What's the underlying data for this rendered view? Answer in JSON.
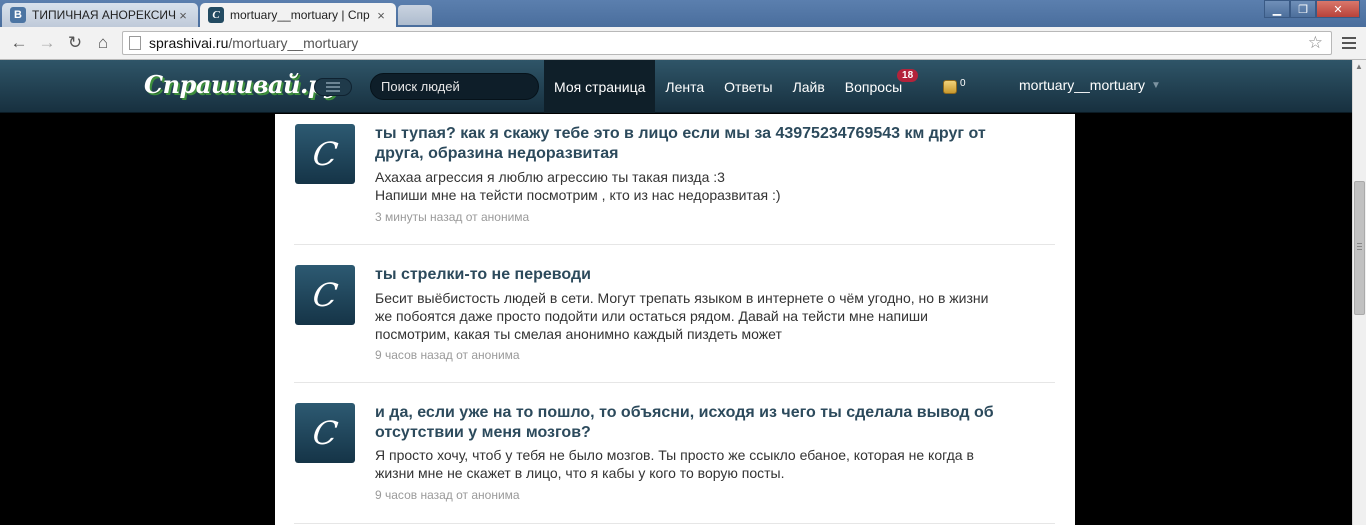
{
  "browser": {
    "tabs": [
      {
        "title": "ТИПИЧНАЯ АНОРЕКСИЧ",
        "favicon": "vk-icon",
        "active": false
      },
      {
        "title": "mortuary__mortuary | Спр",
        "favicon": "sprashivai-icon",
        "active": true
      }
    ],
    "close_glyph": "×",
    "address": {
      "host": "sprashivai.ru",
      "path": "/mortuary__mortuary"
    }
  },
  "site": {
    "logo": "Спрашивай.ру",
    "search_placeholder": "Поиск людей",
    "nav": [
      {
        "label": "Моя страница",
        "active": true
      },
      {
        "label": "Лента"
      },
      {
        "label": "Ответы"
      },
      {
        "label": "Лайв"
      },
      {
        "label": "Вопросы",
        "badge": "18"
      }
    ],
    "coins": "0",
    "username": "mortuary__mortuary",
    "colors": {
      "header_dark": "#17303f",
      "badge": "#b3233b",
      "question": "#2c4a5c"
    }
  },
  "questions": [
    {
      "question": "ты тупая? как я скажу тебе это в лицо если мы за 43975234769543 км друг от друга, образина недоразвитая",
      "answer": "Ахахаа агрессия я люблю агрессию ты такая пизда :3\nНапиши мне на тейсти посмотрим , кто из нас недоразвитая :)",
      "time": "3 минуты назад",
      "author": "от анонима"
    },
    {
      "question": "ты стрелки-то не переводи",
      "answer": "Бесит выёбистость людей в сети. Могут трепать языком в интернете о чём угодно, но в жизни же побоятся даже просто подойти или остаться рядом. Давай на тейсти мне напиши посмотрим, какая ты смелая анонимно каждый пиздеть может",
      "time": "9 часов назад",
      "author": "от анонима"
    },
    {
      "question": "и да, если уже на то пошло, то объясни, исходя из чего ты сделала вывод об отсутствии у меня мозгов?",
      "answer": "Я просто хочу, чтоб у тебя не было мозгов. Ты просто же ссыкло ебаное, которая не когда в жизни мне не скажет в лицо, что я кабы у кого то ворую посты.",
      "time": "9 часов назад",
      "author": "от анонима"
    }
  ]
}
